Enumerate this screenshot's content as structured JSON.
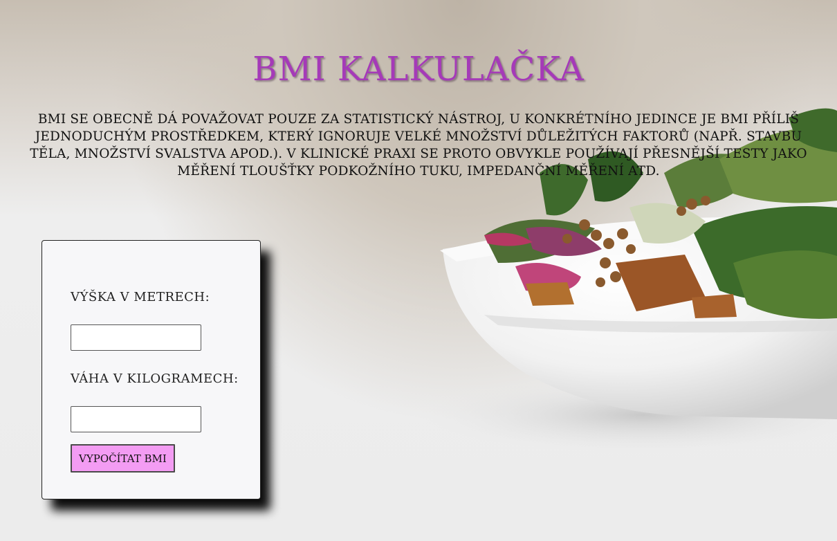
{
  "page": {
    "title": "BMI KALKULAČKA",
    "intro": "BMI SE OBECNĚ DÁ POVAŽOVAT POUZE ZA STATISTICKÝ NÁSTROJ, U KONKRÉTNÍHO JEDINCE JE BMI PŘÍLIŠ JEDNODUCHÝM PROSTŘEDKEM, KTERÝ IGNORUJE VELKÉ MNOŽSTVÍ DŮLEŽITÝCH FAKTORŮ (NAPŘ. STAVBU TĚLA, MNOŽSTVÍ SVALSTVA APOD.). V KLINICKÉ PRAXI SE PROTO OBVYKLE POUŽÍVAJÍ PŘESNĚJŠÍ TESTY JAKO MĚŘENÍ TLOUŠŤKY PODKOŽNÍHO TUKU, IMPEDANČNÍ MĚŘENÍ ATD."
  },
  "form": {
    "height_label": "VÝŠKA V METRECH:",
    "height_value": "",
    "weight_label": "VÁHA V KILOGRAMECH:",
    "weight_value": "",
    "submit_label": "VYPOČÍTAT BMI"
  },
  "colors": {
    "title": "#a53ab8",
    "button": "#f39cf3",
    "card": "#f7f7f9"
  },
  "background": {
    "image": "salad-bowl-photo"
  }
}
